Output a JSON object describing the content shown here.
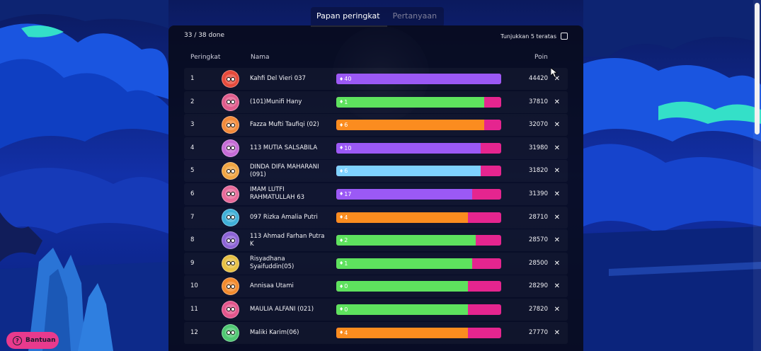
{
  "tabs": [
    {
      "label": "Papan peringkat",
      "active": true
    },
    {
      "label": "Pertanyaan",
      "active": false
    }
  ],
  "progress_text": "33 / 38 done",
  "top5_label": "Tunjukkan 5 teratas",
  "columns": {
    "rank": "Peringkat",
    "name": "Nama",
    "points": "Poin"
  },
  "help_label": "Bantuan",
  "colors": {
    "purple": "#9b59f5",
    "green": "#5ee25e",
    "orange": "#fb8c1f",
    "blue": "#7fd2ff",
    "pink": "#e5258f"
  },
  "rows": [
    {
      "rank": "1",
      "name": "Kahfi Del Vieri 037",
      "streak": "40",
      "points": "44420",
      "fill": 1.0,
      "color": "purple",
      "avatar": "#e64a3b"
    },
    {
      "rank": "2",
      "name": "(101)Munifi Hany",
      "streak": "1",
      "points": "37810",
      "fill": 0.895,
      "color": "green",
      "avatar": "#e05c8c"
    },
    {
      "rank": "3",
      "name": "Fazza Mufti Taufiqi (02)",
      "streak": "6",
      "points": "32070",
      "fill": 0.895,
      "color": "orange",
      "avatar": "#f38a3a"
    },
    {
      "rank": "4",
      "name": "113 MUTIA SALSABILA",
      "streak": "10",
      "points": "31980",
      "fill": 0.875,
      "color": "purple",
      "avatar": "#c56bd6"
    },
    {
      "rank": "5",
      "name": "DINDA DIFA MAHARANI (091)",
      "streak": "6",
      "points": "31820",
      "fill": 0.875,
      "color": "blue",
      "avatar": "#f0a543"
    },
    {
      "rank": "6",
      "name": "IMAM LUTFI RAHMATULLAH 63",
      "streak": "17",
      "points": "31390",
      "fill": 0.825,
      "color": "purple",
      "avatar": "#e86a9a"
    },
    {
      "rank": "7",
      "name": "097 Rizka Amalia Putri",
      "streak": "4",
      "points": "28710",
      "fill": 0.8,
      "color": "orange",
      "avatar": "#3fb0d8"
    },
    {
      "rank": "8",
      "name": "113 Ahmad Farhan Putra K",
      "streak": "2",
      "points": "28570",
      "fill": 0.845,
      "color": "green",
      "avatar": "#8d64d6"
    },
    {
      "rank": "9",
      "name": "Risyadhana Syaifuddin(05)",
      "streak": "1",
      "points": "28500",
      "fill": 0.825,
      "color": "green",
      "avatar": "#e7c043"
    },
    {
      "rank": "10",
      "name": "Annisaa Utami",
      "streak": "0",
      "points": "28290",
      "fill": 0.8,
      "color": "green",
      "avatar": "#f28a2d"
    },
    {
      "rank": "11",
      "name": "MAULIA ALFANI (021)",
      "streak": "0",
      "points": "27820",
      "fill": 0.8,
      "color": "green",
      "avatar": "#e4558c"
    },
    {
      "rank": "12",
      "name": "Maliki Karim(06)",
      "streak": "4",
      "points": "27770",
      "fill": 0.8,
      "color": "orange",
      "avatar": "#4fc872"
    }
  ]
}
